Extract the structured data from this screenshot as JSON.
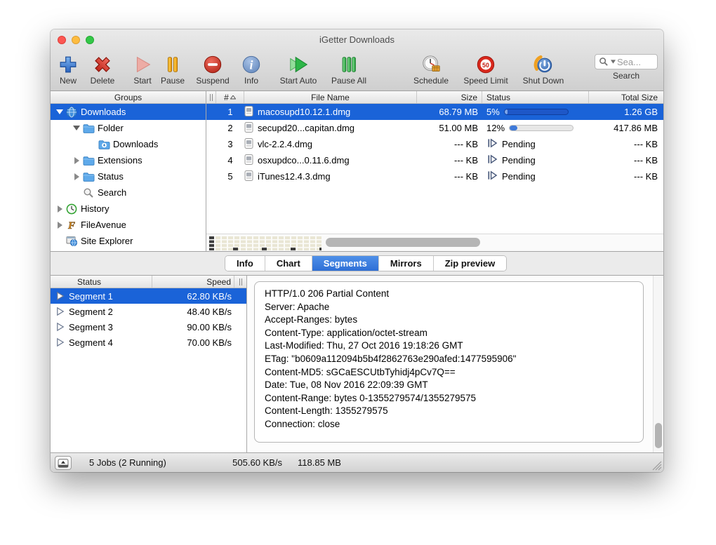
{
  "window": {
    "title": "iGetter Downloads"
  },
  "toolbar": {
    "items": [
      {
        "label": "New"
      },
      {
        "label": "Delete"
      },
      {
        "label": "Start"
      },
      {
        "label": "Pause"
      },
      {
        "label": "Suspend"
      },
      {
        "label": "Info"
      },
      {
        "label": "Start Auto"
      },
      {
        "label": "Pause All"
      },
      {
        "label": "Schedule"
      },
      {
        "label": "Speed Limit"
      },
      {
        "label": "Shut Down"
      }
    ],
    "search": {
      "placeholder": "Sea...",
      "label": "Search"
    }
  },
  "groups": {
    "header": "Groups",
    "items": [
      {
        "label": "Downloads"
      },
      {
        "label": "Folder"
      },
      {
        "label": "Downloads"
      },
      {
        "label": "Extensions"
      },
      {
        "label": "Status"
      },
      {
        "label": "Search"
      },
      {
        "label": "History"
      },
      {
        "label": "FileAvenue"
      },
      {
        "label": "Site Explorer"
      }
    ]
  },
  "files": {
    "columns": {
      "num": "#",
      "sort": "^",
      "name": "File Name",
      "size": "Size",
      "status": "Status",
      "total": "Total Size"
    },
    "rows": [
      {
        "num": "1",
        "name": "macosupd10.12.1.dmg",
        "size": "68.79 MB",
        "status": "5%",
        "progress": 5,
        "total": "1.26 GB"
      },
      {
        "num": "2",
        "name": "secupd20...capitan.dmg",
        "size": "51.00 MB",
        "status": "12%",
        "progress": 12,
        "total": "417.86 MB"
      },
      {
        "num": "3",
        "name": "vlc-2.2.4.dmg",
        "size": "--- KB",
        "status": "Pending",
        "total": "--- KB"
      },
      {
        "num": "4",
        "name": "osxupdco...0.11.6.dmg",
        "size": "--- KB",
        "status": "Pending",
        "total": "--- KB"
      },
      {
        "num": "5",
        "name": "iTunes12.4.3.dmg",
        "size": "--- KB",
        "status": "Pending",
        "total": "--- KB"
      }
    ]
  },
  "tabs": {
    "items": [
      {
        "label": "Info"
      },
      {
        "label": "Chart"
      },
      {
        "label": "Segments"
      },
      {
        "label": "Mirrors"
      },
      {
        "label": "Zip preview"
      }
    ],
    "active": "Segments"
  },
  "segments": {
    "columns": {
      "status": "Status",
      "speed": "Speed"
    },
    "rows": [
      {
        "name": "Segment 1",
        "speed": "62.80 KB/s"
      },
      {
        "name": "Segment 2",
        "speed": "48.40 KB/s"
      },
      {
        "name": "Segment 3",
        "speed": "90.00 KB/s"
      },
      {
        "name": "Segment 4",
        "speed": "70.00 KB/s"
      }
    ]
  },
  "http": {
    "lines": [
      "HTTP/1.0 206 Partial Content",
      "Server: Apache",
      "Accept-Ranges: bytes",
      "Content-Type: application/octet-stream",
      "Last-Modified: Thu, 27 Oct 2016 19:18:26 GMT",
      "ETag: \"b0609a112094b5b4f2862763e290afed:1477595906\"",
      "Content-MD5: sGCaESCUtbTyhidj4pCv7Q==",
      "Date: Tue, 08 Nov 2016 22:09:39 GMT",
      "Content-Range: bytes 0-1355279574/1355279575",
      "Content-Length: 1355279575",
      "Connection: close"
    ]
  },
  "status_bar": {
    "jobs": "5 Jobs (2 Running)",
    "speed": "505.60 KB/s",
    "total": "118.85 MB"
  },
  "colors": {
    "selection_blue": "#1a63d8",
    "tab_active_blue": "#3b7ede",
    "progress_fill": "#3f7ad9"
  }
}
